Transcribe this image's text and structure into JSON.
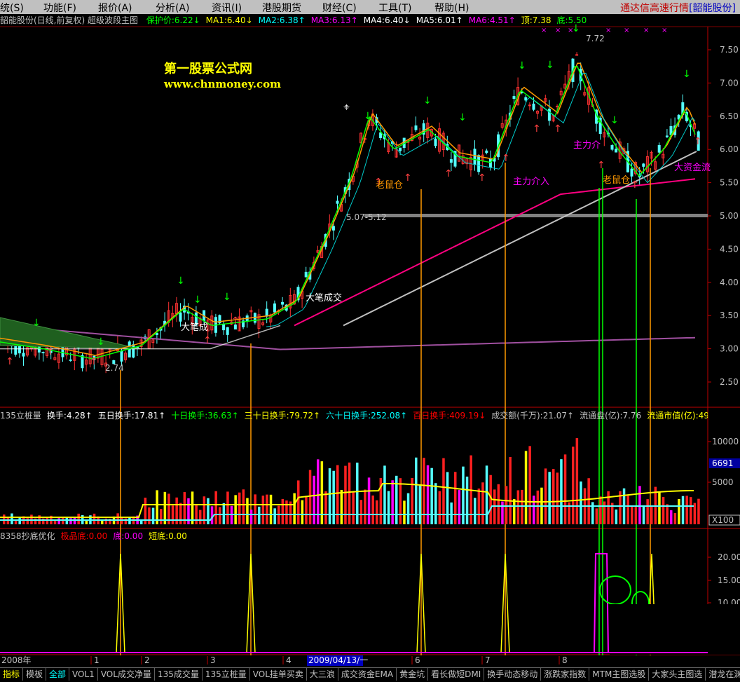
{
  "menu": {
    "items": [
      "统(S)",
      "功能(F)",
      "报价(A)",
      "分析(A)",
      "资讯(I)",
      "港股期货",
      "财经(C)",
      "工具(T)",
      "帮助(H)"
    ],
    "brand_prefix": "通达信高速行情",
    "brand_stock": "[韶能股份]"
  },
  "main_header": {
    "title": "韶能股份(日线,前复权) 超级波段主图",
    "items": [
      {
        "text": "保护价:6.22↓",
        "color": "#00ff00"
      },
      {
        "text": "MA1:6.40↓",
        "color": "#ffff00"
      },
      {
        "text": "MA2:6.38↑",
        "color": "#00ffff"
      },
      {
        "text": "MA3:6.13↑",
        "color": "#ff00ff"
      },
      {
        "text": "MA4:6.40↓",
        "color": "#ffffff"
      },
      {
        "text": "MA5:6.01↑",
        "color": "#ffffff"
      },
      {
        "text": "MA6:4.51↑",
        "color": "#ff00ff"
      },
      {
        "text": "顶:7.38",
        "color": "#ffff00"
      },
      {
        "text": "底:5.50",
        "color": "#00ff00"
      }
    ]
  },
  "watermark": {
    "line1": "第一股票公式网",
    "line2": "www.chnmoney.com"
  },
  "price_axis": [
    "7.50",
    "7.00",
    "6.50",
    "6.00",
    "5.50",
    "5.00",
    "4.50",
    "4.00",
    "3.50",
    "3.00",
    "2.50"
  ],
  "annotations": {
    "high": "7.72",
    "low": "2.74",
    "zone": "5.07-5.12",
    "big_trade": "大笔成交",
    "big_trade_small": "大笔成",
    "rat_bin_1": "老鼠仓",
    "rat_bin_2": "老鼠仓",
    "main_force_1": "主力介入",
    "main_force_2": "主力介",
    "big_money": "大资金流"
  },
  "volume_header": {
    "items": [
      {
        "text": "135立桩量",
        "color": "#c0c0c0"
      },
      {
        "text": "换手:4.28↑",
        "color": "#ffffff"
      },
      {
        "text": "五日换手:17.81↑",
        "color": "#ffffff"
      },
      {
        "text": "十日换手:36.63↑",
        "color": "#00ff00"
      },
      {
        "text": "三十日换手:79.72↑",
        "color": "#ffff00"
      },
      {
        "text": "六十日换手:252.08↑",
        "color": "#00ffff"
      },
      {
        "text": "百日换手:409.19↓",
        "color": "#ff0000"
      },
      {
        "text": "成交额(千万):21.07↑",
        "color": "#c0c0c0"
      },
      {
        "text": "流通盘(亿):7.76",
        "color": "#c0c0c0"
      },
      {
        "text": "流通市值(亿):49",
        "color": "#ffff00"
      }
    ]
  },
  "volume_axis": [
    "10000",
    "5000"
  ],
  "volume_current": "6691",
  "volume_unit": "X100",
  "bottom_header": {
    "items": [
      {
        "text": "8358抄底优化",
        "color": "#c0c0c0"
      },
      {
        "text": "极品底:0.00",
        "color": "#ff0000"
      },
      {
        "text": "底:0.00",
        "color": "#ff00ff"
      },
      {
        "text": "短底:0.00",
        "color": "#ffff00"
      }
    ]
  },
  "bottom_axis": [
    "20.00",
    "15.00",
    "10.00"
  ],
  "time_axis": {
    "year": "2008年",
    "months": [
      "1",
      "2",
      "3",
      "4",
      "6",
      "7",
      "8"
    ],
    "cursor_date": "2009/04/13/一"
  },
  "tabs": [
    "指标",
    "模板",
    "全部",
    "VOL1",
    "VOL成交净量",
    "135成交量",
    "135立桩量",
    "VOL挂单买卖",
    "大三浪",
    "成交资金EMA",
    "黄金坑",
    "看长做短DMI",
    "换手动态移动",
    "涨跌家指数",
    "MTM主图选股",
    "大家头主图选",
    "潜龙在渊选股"
  ],
  "active_tab": "全部",
  "colors": {
    "up": "#ff3232",
    "down": "#54ffff",
    "ma_fast": "#00ff00",
    "ma_mid": "#ff9900",
    "ma_slow": "#ff00ff",
    "ma_long": "#c0c0c0",
    "ma_purple": "#a050a0"
  }
}
